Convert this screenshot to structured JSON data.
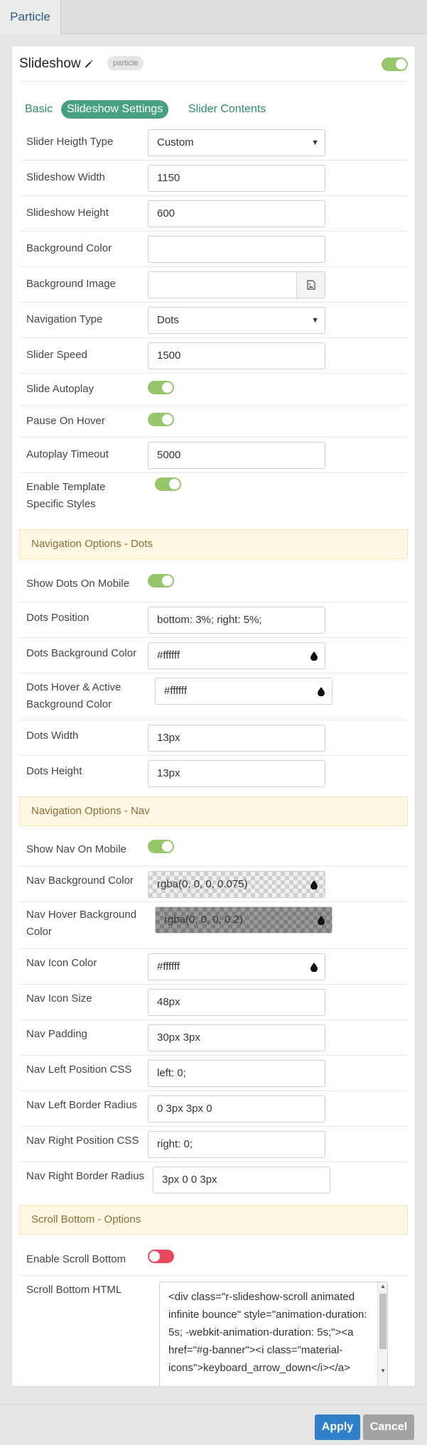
{
  "top_tab": "Particle",
  "particle": {
    "title": "Slideshow",
    "badge": "particle",
    "enabled": true
  },
  "tabs": [
    {
      "label": "Basic",
      "active": false
    },
    {
      "label": "Slideshow Settings",
      "active": true
    },
    {
      "label": "Slider Contents",
      "active": false
    }
  ],
  "fields": {
    "height_type": {
      "label": "Slider Heigth Type",
      "value": "Custom"
    },
    "width": {
      "label": "Slideshow Width",
      "value": "1150"
    },
    "height": {
      "label": "Slideshow Height",
      "value": "600"
    },
    "bg_color": {
      "label": "Background Color",
      "value": ""
    },
    "bg_image": {
      "label": "Background Image",
      "value": ""
    },
    "nav_type": {
      "label": "Navigation Type",
      "value": "Dots"
    },
    "speed": {
      "label": "Slider Speed",
      "value": "1500"
    },
    "autoplay": {
      "label": "Slide Autoplay",
      "on": true
    },
    "pause_hover": {
      "label": "Pause On Hover",
      "on": true
    },
    "autoplay_timeout": {
      "label": "Autoplay Timeout",
      "value": "5000"
    },
    "template_styles": {
      "label": "Enable Template Specific Styles",
      "on": true
    }
  },
  "sections": {
    "dots": "Navigation Options - Dots",
    "nav": "Navigation Options - Nav",
    "scroll": "Scroll Bottom - Options"
  },
  "dots": {
    "show_mobile": {
      "label": "Show Dots On Mobile",
      "on": true
    },
    "position": {
      "label": "Dots Position",
      "value": "bottom: 3%; right: 5%;"
    },
    "bg_color": {
      "label": "Dots Background Color",
      "value": "#ffffff"
    },
    "hover_color": {
      "label": "Dots Hover & Active Background Color",
      "value": "#ffffff"
    },
    "width": {
      "label": "Dots Width",
      "value": "13px"
    },
    "height": {
      "label": "Dots Height",
      "value": "13px"
    }
  },
  "nav": {
    "show_mobile": {
      "label": "Show Nav On Mobile",
      "on": true
    },
    "bg_color": {
      "label": "Nav Background Color",
      "value": "rgba(0, 0, 0, 0.075)"
    },
    "hover_bg": {
      "label": "Nav Hover Background Color",
      "value": "rgba(0, 0, 0, 0.2)"
    },
    "icon_color": {
      "label": "Nav Icon Color",
      "value": "#ffffff"
    },
    "icon_size": {
      "label": "Nav Icon Size",
      "value": "48px"
    },
    "padding": {
      "label": "Nav Padding",
      "value": "30px 3px"
    },
    "left_pos": {
      "label": "Nav Left Position CSS",
      "value": "left: 0;"
    },
    "left_radius": {
      "label": "Nav Left Border Radius",
      "value": "0 3px 3px 0"
    },
    "right_pos": {
      "label": "Nav Right Position CSS",
      "value": "right: 0;"
    },
    "right_radius": {
      "label": "Nav Right Border Radius",
      "value": "3px 0 0 3px"
    }
  },
  "scroll": {
    "enable": {
      "label": "Enable Scroll Bottom",
      "on": false
    },
    "html": {
      "label": "Scroll Bottom HTML",
      "value": "<div class=\"r-slideshow-scroll animated infinite bounce\" style=\"animation-duration: 5s; -webkit-animation-duration: 5s;\"><a href=\"#g-banner\"><i class=\"material-icons\">keyboard_arrow_down</i></a>"
    }
  },
  "footer": {
    "apply": "Apply",
    "cancel": "Cancel"
  },
  "colors": {
    "accent": "#46a081",
    "toggle_on": "#96c66a",
    "toggle_off": "#e6465e",
    "section_bg": "#fcf8e3",
    "apply": "#2f80c9"
  },
  "icons": {
    "edit": "pencil-icon",
    "image": "image-picker-icon",
    "color": "droplet-icon"
  }
}
